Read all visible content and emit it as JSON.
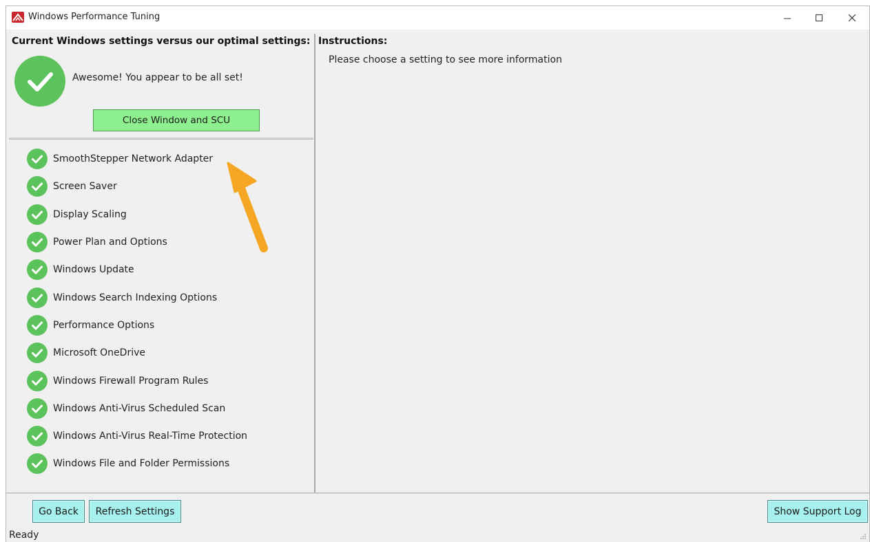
{
  "window": {
    "title": "Windows Performance Tuning",
    "controls": {
      "minimize_icon": "minimize-icon",
      "maximize_icon": "maximize-icon",
      "close_icon": "close-icon"
    }
  },
  "left_panel": {
    "heading": "Current Windows settings versus our optimal settings:",
    "status_icon": "check-circle-icon",
    "status_text": "Awesome! You appear to be all set!",
    "close_button": "Close Window and SCU",
    "settings": [
      {
        "label": "SmoothStepper Network Adapter",
        "status": "ok"
      },
      {
        "label": "Screen Saver",
        "status": "ok"
      },
      {
        "label": "Display Scaling",
        "status": "ok"
      },
      {
        "label": "Power Plan and Options",
        "status": "ok"
      },
      {
        "label": "Windows Update",
        "status": "ok"
      },
      {
        "label": "Windows Search Indexing Options",
        "status": "ok"
      },
      {
        "label": "Performance Options",
        "status": "ok"
      },
      {
        "label": "Microsoft OneDrive",
        "status": "ok"
      },
      {
        "label": "Windows Firewall Program Rules",
        "status": "ok"
      },
      {
        "label": "Windows Anti-Virus Scheduled Scan",
        "status": "ok"
      },
      {
        "label": "Windows Anti-Virus Real-Time Protection",
        "status": "ok"
      },
      {
        "label": "Windows File and Folder Permissions",
        "status": "ok"
      }
    ]
  },
  "right_panel": {
    "heading": "Instructions:",
    "text": "Please choose a setting to see more information"
  },
  "buttons": {
    "go_back": "Go Back",
    "refresh_settings": "Refresh Settings",
    "show_support_log": "Show Support Log"
  },
  "status_bar": {
    "text": "Ready"
  },
  "annotation": {
    "icon": "arrow-pointer-icon",
    "color": "#f5a623"
  },
  "colors": {
    "check_green": "#5cc25c",
    "close_button_bg": "#8ef08e",
    "action_button_bg": "#a6f0ee",
    "logo_red": "#c8282d"
  }
}
